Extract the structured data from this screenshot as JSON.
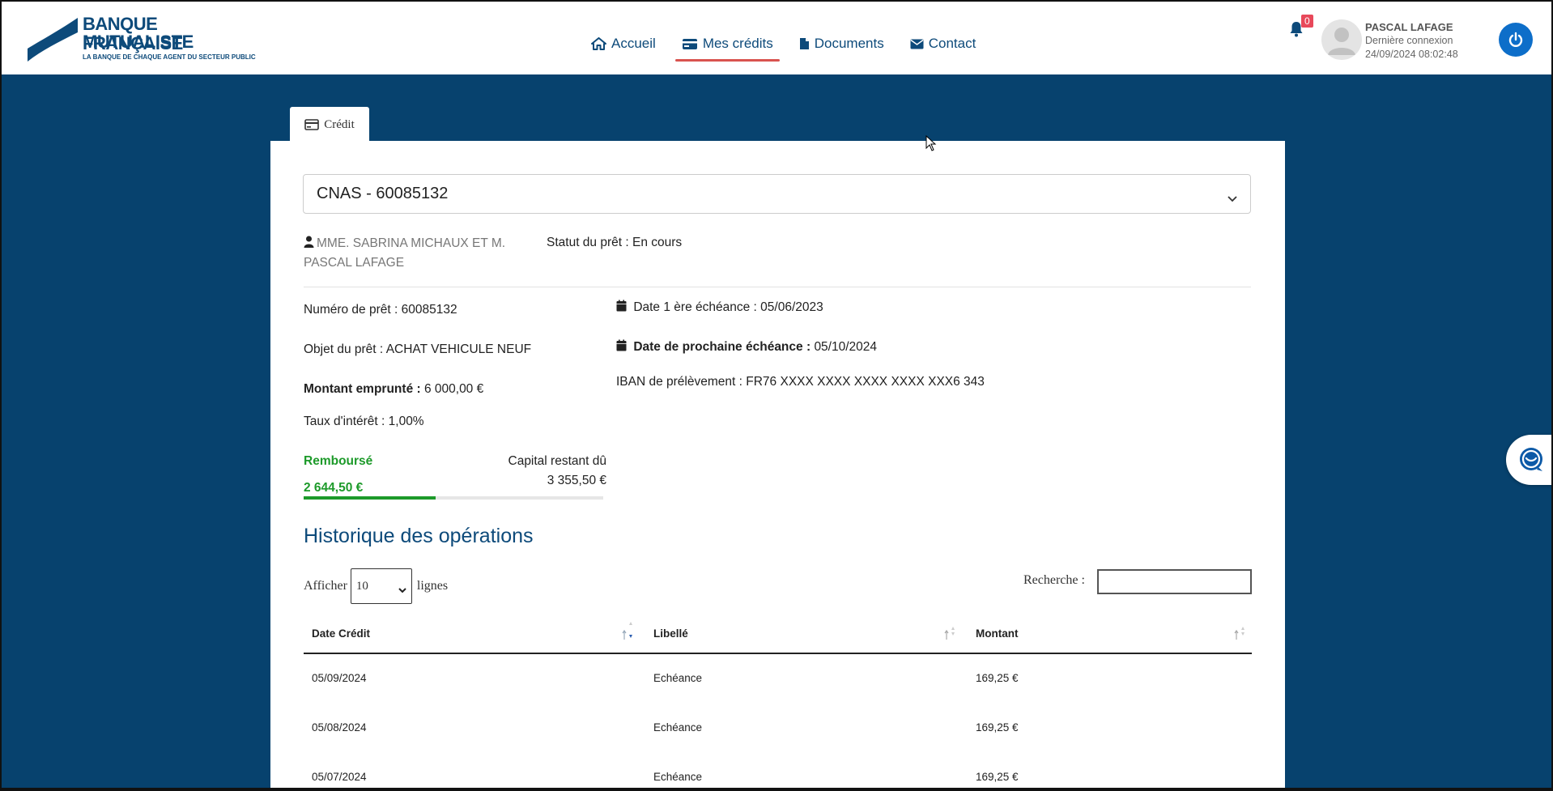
{
  "brand": {
    "line1": "BANQUE FRANÇAISE",
    "line2": "MUTUALISTE",
    "tagline": "LA BANQUE DE CHAQUE AGENT DU SECTEUR PUBLIC",
    "color": "#0d4a7a"
  },
  "nav": {
    "items": [
      {
        "label": "Accueil",
        "icon": "home-icon"
      },
      {
        "label": "Mes crédits",
        "icon": "credit-card-icon",
        "active": true
      },
      {
        "label": "Documents",
        "icon": "file-icon"
      },
      {
        "label": "Contact",
        "icon": "envelope-icon"
      }
    ]
  },
  "user": {
    "notifications": "0",
    "name": "PASCAL LAFAGE",
    "last_login_label": "Dernière connexion",
    "last_login": "24/09/2024 08:02:48"
  },
  "tab": {
    "label": "Crédit"
  },
  "loan": {
    "selected": "CNAS - 60085132",
    "holder_line1": "MME. SABRINA MICHAUX ET M.",
    "holder_line2": "PASCAL LAFAGE",
    "status_label": "Statut du prêt :",
    "status_value": "En cours",
    "number_label": "Numéro de prêt :",
    "number_value": "60085132",
    "object_label": "Objet du prêt :",
    "object_value": "ACHAT VEHICULE NEUF",
    "amount_label": "Montant emprunté :",
    "amount_value": "6 000,00 €",
    "rate_label": "Taux d'intérêt :",
    "rate_value": "1,00%",
    "first_due_label": "Date 1 ère échéance :",
    "first_due_value": "05/06/2023",
    "next_due_label": "Date de prochaine échéance :",
    "next_due_value": "05/10/2024",
    "iban_label": "IBAN de prélèvement :",
    "iban_value": "FR76 XXXX XXXX XXXX XXXX XXX6 343",
    "repaid_label": "Remboursé",
    "repaid_value": "2 644,50 €",
    "remaining_label": "Capital restant dû",
    "remaining_value": "3 355,50 €",
    "repaid_fraction": 0.44
  },
  "history": {
    "title": "Historique des opérations",
    "show_label": "Afficher",
    "show_value": "10",
    "rows_label": "lignes",
    "search_label": "Recherche :",
    "columns": [
      "Date Crédit",
      "Libellé",
      "Montant"
    ],
    "rows": [
      [
        "05/09/2024",
        "Echéance",
        "169,25 €"
      ],
      [
        "05/08/2024",
        "Echéance",
        "169,25 €"
      ],
      [
        "05/07/2024",
        "Echéance",
        "169,25 €"
      ]
    ]
  }
}
